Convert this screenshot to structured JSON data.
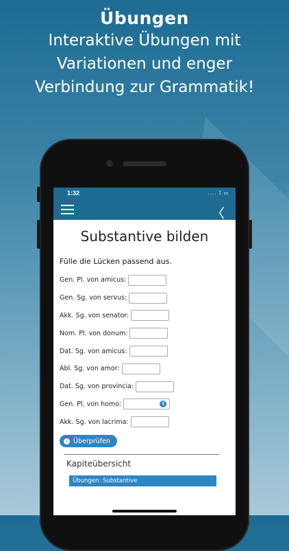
{
  "headline": {
    "title": "Übungen",
    "line1": "Interaktive Übungen mit",
    "line2": "Variationen und enger",
    "line3": "Verbindung zur Grammatik!"
  },
  "status": {
    "time": "1:32",
    "icons": ".... ⟟ ▭"
  },
  "nav": {
    "menu_icon": "menu-icon",
    "back_icon": "chevron-left-icon",
    "back_glyph": "〈"
  },
  "page": {
    "title": "Substantive bilden",
    "instruction": "Fülle die Lücken passend aus.",
    "rows": [
      {
        "label": "Gen. Pl. von amicus:",
        "value": ""
      },
      {
        "label": "Gen. Sg. von servus:",
        "value": ""
      },
      {
        "label": "Akk. Sg. von senator:",
        "value": ""
      },
      {
        "label": "Nom. Pl. von donum:",
        "value": ""
      },
      {
        "label": "Dat. Sg. von amicus:",
        "value": ""
      },
      {
        "label": "Abl. Sg. von amor:",
        "value": ""
      },
      {
        "label": "Dat. Sg. von provincia:",
        "value": ""
      },
      {
        "label": "Gen. Pl. von homo:",
        "value": ""
      },
      {
        "label": "Akk. Sg. von lacrima:",
        "value": ""
      }
    ],
    "check_button": "Überprüfen",
    "info_glyph": "i",
    "ok_glyph": "✓"
  },
  "chapter": {
    "title": "Kapiteübersicht",
    "items": [
      "Übungen: Substantive"
    ]
  },
  "colors": {
    "brand": "#1d6b93",
    "accent": "#2c86c4"
  }
}
